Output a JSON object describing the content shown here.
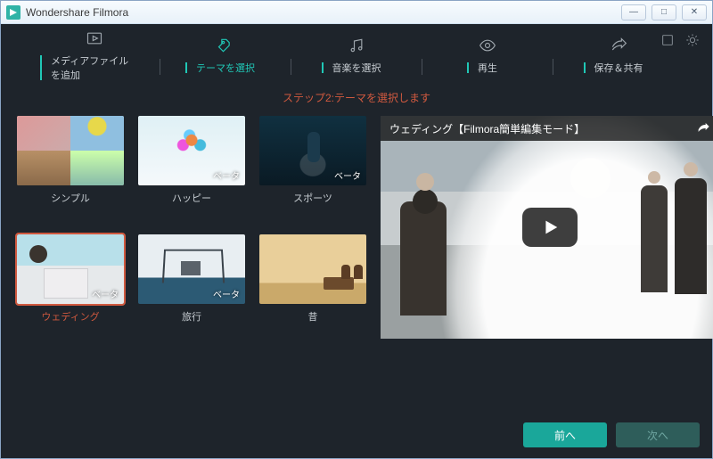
{
  "window": {
    "title": "Wondershare Filmora"
  },
  "steps": [
    {
      "label": "メディアファイルを追加"
    },
    {
      "label": "テーマを選択"
    },
    {
      "label": "音楽を選択"
    },
    {
      "label": "再生"
    },
    {
      "label": "保存＆共有"
    }
  ],
  "active_step_index": 1,
  "caption": "ステップ2:テーマを選択します",
  "themes": [
    {
      "label": "シンプル",
      "beta": false
    },
    {
      "label": "ハッピー",
      "beta": true
    },
    {
      "label": "スポーツ",
      "beta": true
    },
    {
      "label": "ウェディング",
      "beta": true
    },
    {
      "label": "旅行",
      "beta": true
    },
    {
      "label": "昔",
      "beta": false
    }
  ],
  "beta_tag": "ベータ",
  "selected_theme_index": 3,
  "preview": {
    "title": "ウェディング【Filmora簡単編集モード】"
  },
  "footer": {
    "prev": "前へ",
    "next": "次へ"
  },
  "colors": {
    "accent": "#20c7b6",
    "highlight": "#d0593f",
    "bg": "#1e242b"
  }
}
